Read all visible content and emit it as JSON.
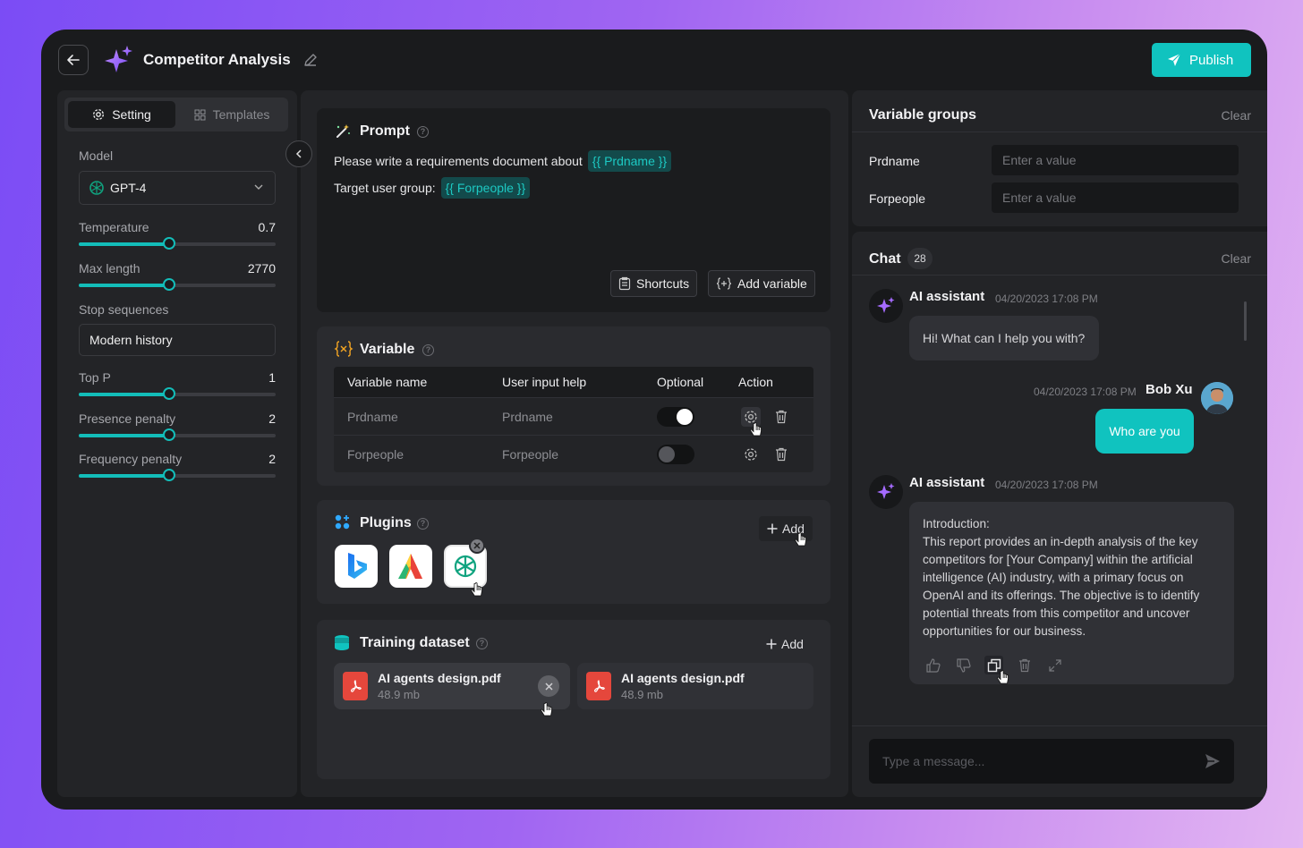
{
  "header": {
    "title": "Competitor Analysis",
    "publish_label": "Publish"
  },
  "left": {
    "tabs": [
      {
        "label": "Setting",
        "icon": "gear-icon",
        "active": true
      },
      {
        "label": "Templates",
        "icon": "grid-icon",
        "active": false
      }
    ],
    "model_label": "Model",
    "model_value": "GPT-4",
    "params": [
      {
        "label": "Temperature",
        "value": "0.7",
        "fraction": 0.46
      },
      {
        "label": "Max length",
        "value": "2770",
        "fraction": 0.46
      }
    ],
    "stop_label": "Stop sequences",
    "stop_value": "Modern history",
    "params2": [
      {
        "label": "Top P",
        "value": "1",
        "fraction": 0.46
      },
      {
        "label": "Presence penalty",
        "value": "2",
        "fraction": 0.46
      },
      {
        "label": "Frequency penalty",
        "value": "2",
        "fraction": 0.46
      }
    ]
  },
  "prompt": {
    "title": "Prompt",
    "line1_text": "Please write a requirements document about",
    "line1_var": "{{ Prdname }}",
    "line2_text": "Target user group:",
    "line2_var": "{{ Forpeople }}",
    "shortcuts_label": "Shortcuts",
    "add_variable_label": "Add variable"
  },
  "variable": {
    "title": "Variable",
    "columns": [
      "Variable name",
      "User input help",
      "Optional",
      "Action"
    ],
    "rows": [
      {
        "name": "Prdname",
        "help": "Prdname",
        "optional": true
      },
      {
        "name": "Forpeople",
        "help": "Forpeople",
        "optional": false
      }
    ]
  },
  "plugins": {
    "title": "Plugins",
    "add_label": "Add",
    "items": [
      "bing-icon",
      "arc-icon",
      "openai-icon"
    ]
  },
  "dataset": {
    "title": "Training dataset",
    "add_label": "Add",
    "files": [
      {
        "name": "AI agents design.pdf",
        "size": "48.9 mb"
      },
      {
        "name": "AI agents design.pdf",
        "size": "48.9 mb"
      }
    ]
  },
  "variable_groups": {
    "title": "Variable groups",
    "clear_label": "Clear",
    "fields": [
      {
        "label": "Prdname",
        "placeholder": "Enter a value"
      },
      {
        "label": "Forpeople",
        "placeholder": "Enter a value"
      }
    ]
  },
  "chat": {
    "title": "Chat",
    "count": "28",
    "clear_label": "Clear",
    "messages": [
      {
        "sender": "AI assistant",
        "time": "04/20/2023 17:08 PM",
        "text": "Hi! What can I help you with?"
      },
      {
        "sender": "Bob Xu",
        "time": "04/20/2023 17:08 PM",
        "text": "Who are you"
      },
      {
        "sender": "AI assistant",
        "time": "04/20/2023 17:08 PM",
        "text": "Introduction:\nThis report provides an in-depth analysis of the key competitors for [Your Company] within the artificial intelligence (AI) industry, with a primary focus on OpenAI and its offerings. The objective is to identify potential threats from this competitor and uncover opportunities for our business."
      }
    ],
    "input_placeholder": "Type a message..."
  },
  "colors": {
    "accent": "#10c3bf",
    "background_gradient_start": "#7b4cf5",
    "background_gradient_end": "#e3b6f2",
    "panel": "#232427"
  }
}
